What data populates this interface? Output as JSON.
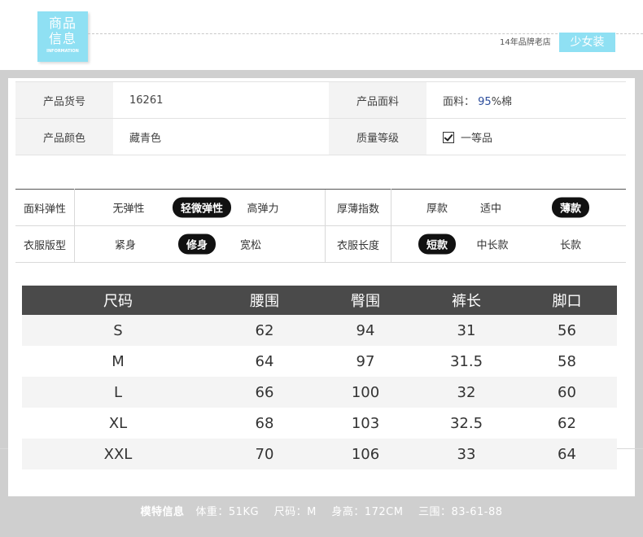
{
  "header": {
    "logo_line1": "商品",
    "logo_line2": "信息",
    "logo_en": "INFORMATION",
    "shop_text": "14年品牌老店",
    "shop_tag": "少女装"
  },
  "info": {
    "item_no_label": "产品货号",
    "item_no_value": "16261",
    "fabric_label": "产品面料",
    "fabric_prefix": "面料：",
    "fabric_percent": "95",
    "fabric_suffix": "%棉",
    "color_label": "产品颜色",
    "color_value": "藏青色",
    "quality_label": "质量等级",
    "quality_value": "一等品"
  },
  "attributes": {
    "elasticity_label": "面料弹性",
    "elasticity_options": [
      "无弹性",
      "轻微弹性",
      "高弹力"
    ],
    "elasticity_selected": "轻微弹性",
    "thickness_label": "厚薄指数",
    "thickness_options": [
      "厚款",
      "适中",
      "薄款"
    ],
    "thickness_selected": "薄款",
    "fit_label": "衣服版型",
    "fit_options": [
      "紧身",
      "修身",
      "宽松"
    ],
    "fit_selected": "修身",
    "length_label": "衣服长度",
    "length_options": [
      "短款",
      "中长款",
      "长款"
    ],
    "length_selected": "短款"
  },
  "size_table": {
    "headers": [
      "尺码",
      "腰围",
      "臀围",
      "裤长",
      "脚口"
    ],
    "rows": [
      [
        "S",
        "62",
        "94",
        "31",
        "56"
      ],
      [
        "M",
        "64",
        "97",
        "31.5",
        "58"
      ],
      [
        "L",
        "66",
        "100",
        "32",
        "60"
      ],
      [
        "XL",
        "68",
        "103",
        "32.5",
        "62"
      ],
      [
        "XXL",
        "70",
        "106",
        "33",
        "64"
      ]
    ]
  },
  "footer": {
    "model_label": "模特信息",
    "weight": "体重：51KG",
    "size": "尺码：M",
    "height": "身高：172CM",
    "measurements": "三围：83-61-88"
  },
  "colors": {
    "accent": "#8fe0f3",
    "frame": "#cfcfcf",
    "table_header": "#4a4a4a",
    "selected_pill": "#111111"
  }
}
